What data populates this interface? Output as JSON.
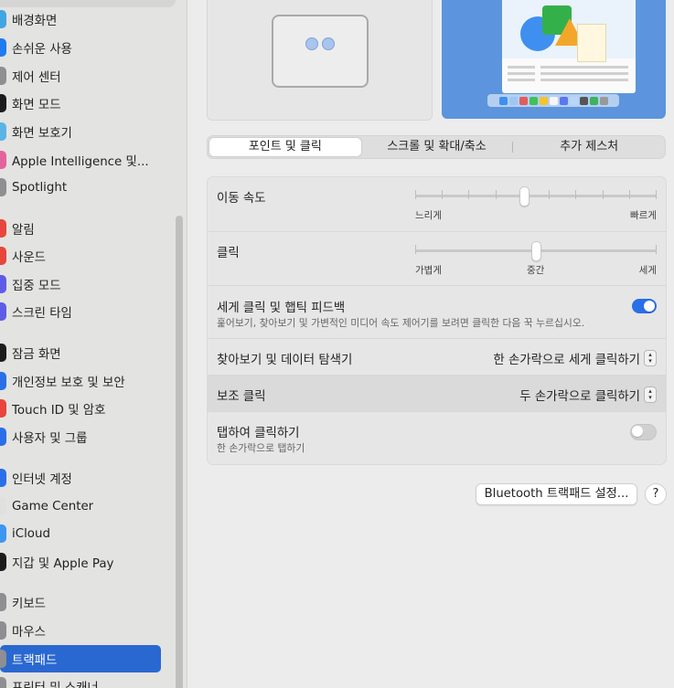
{
  "sidebar": {
    "items": [
      {
        "label": "배경화면",
        "icon": "wallpaper-icon",
        "color": "#41a6e0"
      },
      {
        "label": "손쉬운 사용",
        "icon": "accessibility-icon",
        "color": "#1e7bf0"
      },
      {
        "label": "제어 센터",
        "icon": "control-center-icon",
        "color": "#8e8e93"
      },
      {
        "label": "화면 모드",
        "icon": "appearance-icon",
        "color": "#1c1c1e"
      },
      {
        "label": "화면 보호기",
        "icon": "screen-saver-icon",
        "color": "#5ab4e5"
      },
      {
        "label": "Apple Intelligence 및...",
        "icon": "apple-intelligence-icon",
        "color": "#e5639b"
      },
      {
        "label": "Spotlight",
        "icon": "spotlight-icon",
        "color": "#8e8e93"
      },
      {
        "label": "알림",
        "icon": "notifications-icon",
        "color": "#e8453c"
      },
      {
        "label": "사운드",
        "icon": "sound-icon",
        "color": "#e8453c"
      },
      {
        "label": "집중 모드",
        "icon": "focus-icon",
        "color": "#5e5ce6"
      },
      {
        "label": "스크린 타임",
        "icon": "screen-time-icon",
        "color": "#5e5ce6"
      },
      {
        "label": "잠금 화면",
        "icon": "lock-screen-icon",
        "color": "#1c1c1e"
      },
      {
        "label": "개인정보 보호 및 보안",
        "icon": "privacy-hand-icon",
        "color": "#2a6fe8"
      },
      {
        "label": "Touch ID 및 암호",
        "icon": "touch-id-icon",
        "color": "#e8453c"
      },
      {
        "label": "사용자 및 그룹",
        "icon": "users-groups-icon",
        "color": "#2a6fe8"
      },
      {
        "label": "인터넷 계정",
        "icon": "internet-accounts-icon",
        "color": "#2a6fe8"
      },
      {
        "label": "Game Center",
        "icon": "game-center-icon",
        "color": "#e0e0e0"
      },
      {
        "label": "iCloud",
        "icon": "icloud-icon",
        "color": "#3d96f2"
      },
      {
        "label": "지갑 및 Apple Pay",
        "icon": "wallet-icon",
        "color": "#1c1c1e"
      },
      {
        "label": "키보드",
        "icon": "keyboard-icon",
        "color": "#8e8e93"
      },
      {
        "label": "마우스",
        "icon": "mouse-icon",
        "color": "#8e8e93"
      },
      {
        "label": "트랙패드",
        "icon": "trackpad-icon",
        "color": "#8e8e93"
      },
      {
        "label": "프린터 및 스캐너",
        "icon": "printer-icon",
        "color": "#8e8e93"
      }
    ]
  },
  "tabs": [
    "포인트 및 클릭",
    "스크롤 및 확대/축소",
    "추가 제스처"
  ],
  "settings": {
    "tracking_speed": {
      "label": "이동 속도",
      "min_label": "느리게",
      "max_label": "빠르게",
      "value": 0.45
    },
    "click": {
      "label": "클릭",
      "min_label": "가볍게",
      "mid_label": "중간",
      "max_label": "세게",
      "value": 0.5
    },
    "force_click": {
      "label": "세게 클릭 및 햅틱 피드백",
      "description": "훑어보기, 찾아보기 및 가변적인 미디어 속도 제어기를 보려면 클릭한 다음 꾹 누르십시오.",
      "enabled": true
    },
    "lookup": {
      "label": "찾아보기 및 데이터 탐색기",
      "value": "한 손가락으로 세게 클릭하기"
    },
    "secondary_click": {
      "label": "보조 클릭",
      "value": "두 손가락으로 클릭하기"
    },
    "tap_to_click": {
      "label": "탭하여 클릭하기",
      "description": "한 손가락으로 탭하기",
      "enabled": false
    }
  },
  "buttons": {
    "bluetooth": "Bluetooth 트랙패드 설정...",
    "help": "?"
  },
  "colors": {
    "accent": "#2a6fe8",
    "selected_sidebar": "#2a68d1"
  }
}
